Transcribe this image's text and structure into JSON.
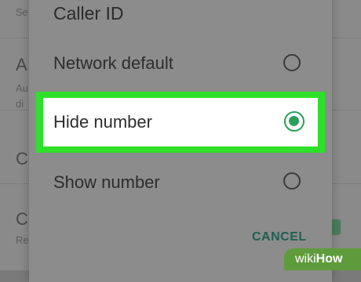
{
  "background": {
    "rows": [
      {
        "title": "",
        "subtitle": "Se"
      },
      {
        "title": "A",
        "subtitle": "Au"
      },
      {
        "title": "",
        "subtitle": "di"
      },
      {
        "title": "C",
        "subtitle": ""
      },
      {
        "title": "C",
        "subtitle": "Re"
      }
    ]
  },
  "dialog": {
    "title": "Caller ID",
    "options": [
      {
        "label": "Network default",
        "selected": false
      },
      {
        "label": "Hide number",
        "selected": true
      },
      {
        "label": "Show number",
        "selected": false
      }
    ],
    "cancel_label": "CANCEL"
  },
  "colors": {
    "highlight": "#2ee02a",
    "radio_selected": "#2c9e5b",
    "cancel": "#1f5f50"
  },
  "watermark": {
    "text_a": "wiki",
    "text_b": "How"
  }
}
